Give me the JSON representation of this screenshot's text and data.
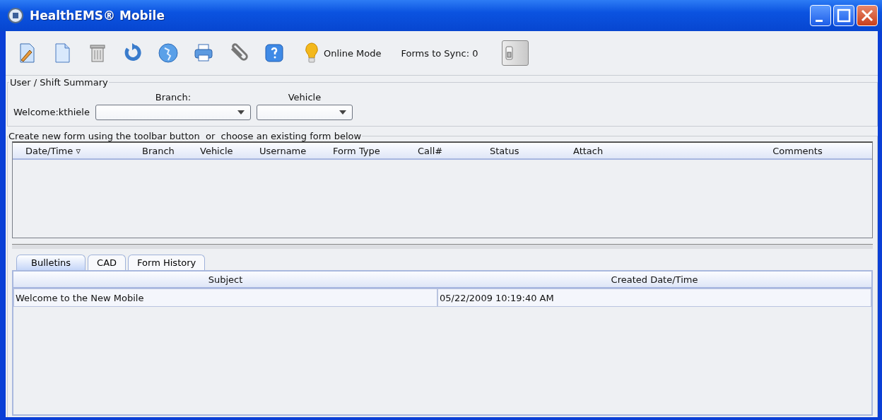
{
  "window": {
    "title": "HealthEMS® Mobile"
  },
  "toolbar": {
    "buttons": [
      {
        "kind": "edit"
      },
      {
        "kind": "new"
      },
      {
        "kind": "delete"
      },
      {
        "kind": "refresh"
      },
      {
        "kind": "globe"
      },
      {
        "kind": "print"
      },
      {
        "kind": "attach"
      },
      {
        "kind": "help"
      }
    ],
    "mode": "Online Mode",
    "sync_label": "Forms to Sync: 0",
    "sync_switch": {
      "on": false
    }
  },
  "user_summary": {
    "title": "User / Shift Summary",
    "welcome": "Welcome:kthiele",
    "branch_label": "Branch:",
    "vehicle_label": "Vehicle"
  },
  "forms": {
    "title": "Create new form using the toolbar button  or  choose an existing form below",
    "columns": [
      "Date/Time ▿",
      "Branch",
      "Vehicle",
      "Username",
      "Form Type",
      "Call#",
      "Status",
      "Attach",
      "Comments"
    ]
  },
  "tabs": [
    {
      "label": "Bulletins",
      "selected": true
    },
    {
      "label": "CAD",
      "selected": false
    },
    {
      "label": "Form History",
      "selected": false
    }
  ],
  "bulletins": {
    "columns": [
      "Subject",
      "Created Date/Time"
    ],
    "rows": [
      [
        "Welcome to the New Mobile",
        "05/22/2009 10:19:40 AM"
      ]
    ]
  }
}
